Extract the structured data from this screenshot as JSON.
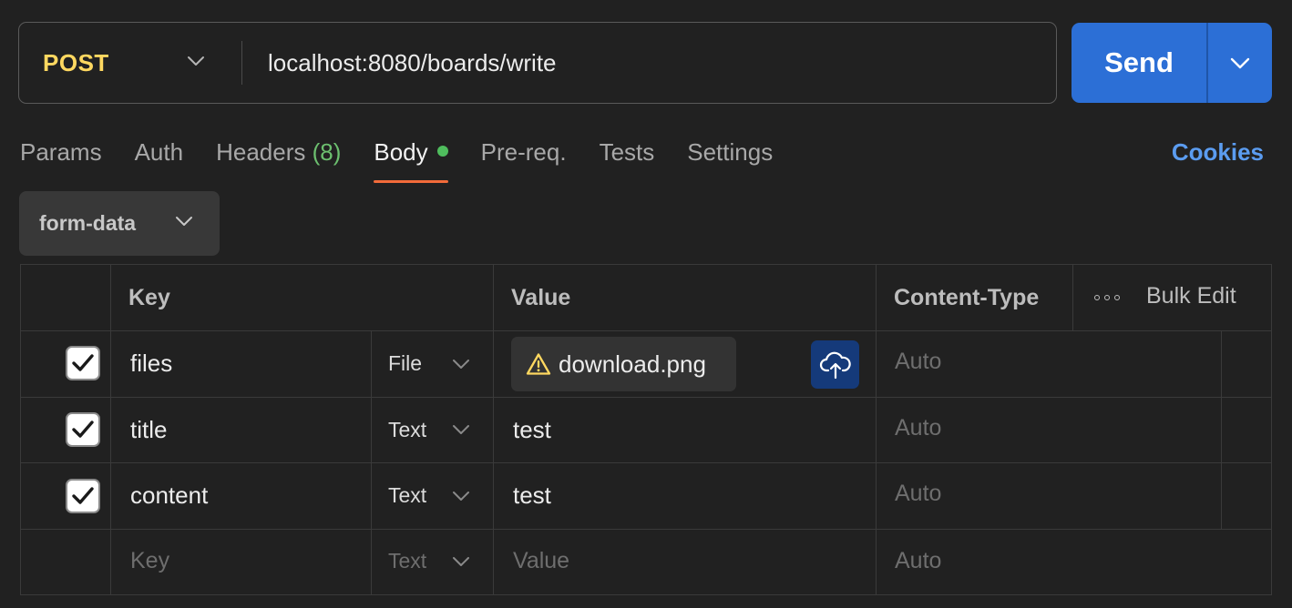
{
  "request": {
    "method": "POST",
    "url": "localhost:8080/boards/write"
  },
  "send": {
    "label": "Send"
  },
  "tabs": [
    {
      "label": "Params"
    },
    {
      "label": "Auth"
    },
    {
      "label": "Headers",
      "count": "(8)"
    },
    {
      "label": "Body"
    },
    {
      "label": "Pre-req."
    },
    {
      "label": "Tests"
    },
    {
      "label": "Settings"
    }
  ],
  "cookies_label": "Cookies",
  "body_type": "form-data",
  "table": {
    "headers": {
      "key": "Key",
      "value": "Value",
      "content_type": "Content-Type",
      "bulk_edit": "Bulk Edit"
    },
    "rows": [
      {
        "key": "files",
        "type": "File",
        "value": "download.png",
        "content_type": "Auto"
      },
      {
        "key": "title",
        "type": "Text",
        "value": "test",
        "content_type": "Auto"
      },
      {
        "key": "content",
        "type": "Text",
        "value": "test",
        "content_type": "Auto"
      }
    ],
    "placeholder_row": {
      "key": "Key",
      "type": "Text",
      "value": "Value",
      "content_type": "Auto"
    }
  },
  "colors": {
    "background": "#212121",
    "method": "#ffd860",
    "send": "#2c6fd6",
    "active_tab_underline": "#f26b3a",
    "body_dot": "#4fbd5d",
    "cookies": "#5b9cf0",
    "warning": "#ffd860",
    "upload_button": "#153a7a"
  },
  "icons": {
    "method_dropdown": "chevron-down-icon",
    "send_dropdown": "chevron-down-icon",
    "checkbox": "checkmark-icon",
    "file_warning": "warning-triangle-icon",
    "upload": "cloud-upload-icon",
    "more": "more-horizontal-icon"
  }
}
